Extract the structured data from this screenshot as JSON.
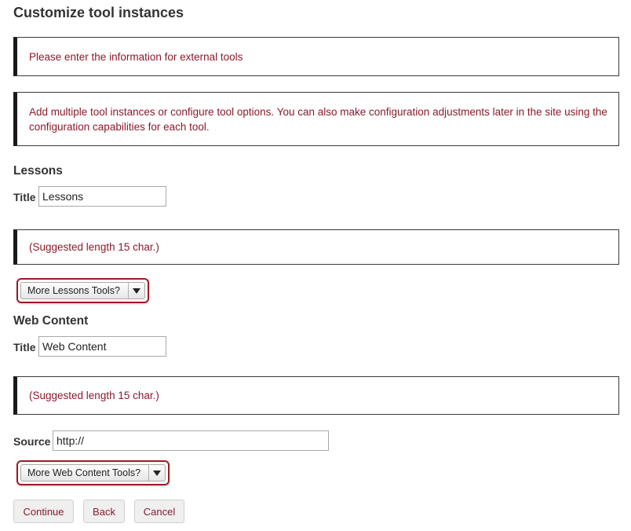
{
  "page": {
    "title": "Customize tool instances"
  },
  "messages": {
    "external": "Please enter the information for external tools",
    "instructions": "Add multiple tool instances or configure tool options. You can also make configuration adjustments later in the site using the configuration capabilities for each tool."
  },
  "lessons": {
    "heading": "Lessons",
    "title_label": "Title",
    "title_value": "Lessons",
    "hint": "(Suggested length 15 char.)",
    "more_tools": "More Lessons Tools?"
  },
  "web_content": {
    "heading": "Web Content",
    "title_label": "Title",
    "title_value": "Web Content",
    "hint": "(Suggested length 15 char.)",
    "source_label": "Source",
    "source_value": "http://",
    "more_tools": "More Web Content Tools?"
  },
  "buttons": {
    "continue": "Continue",
    "back": "Back",
    "cancel": "Cancel"
  },
  "colors": {
    "message_text": "#8b1a2a",
    "highlight_border": "#9e1b24",
    "box_left_bar": "#1a1a1a"
  },
  "icons": {
    "dropdown": "triangle-down-icon"
  }
}
